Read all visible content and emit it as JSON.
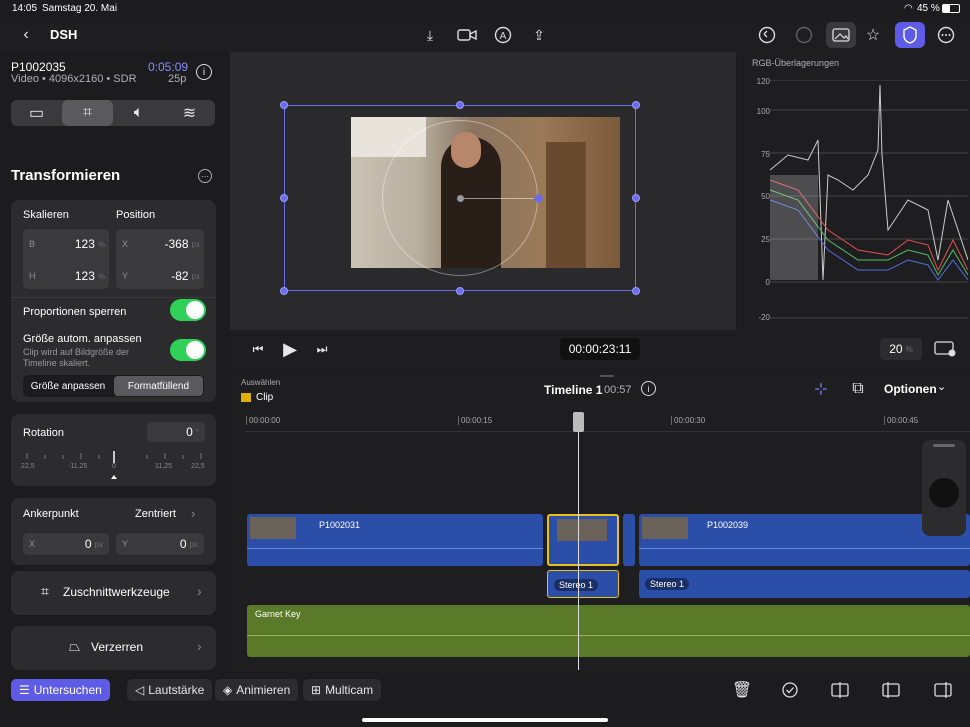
{
  "status": {
    "time": "14:05",
    "date": "Samstag 20. Mai",
    "battery": "45 %"
  },
  "topbar": {
    "project": "DSH",
    "back_icon": "chevron-left-icon"
  },
  "clipinfo": {
    "name": "P1002035",
    "timecode": "0:05:09",
    "meta": "Video • 4096x2160 • SDR",
    "fps": "25p"
  },
  "inspector": {
    "title": "Transformieren",
    "scale_label": "Skalieren",
    "position_label": "Position",
    "scale_w_label": "B",
    "scale_w": "123",
    "scale_h_label": "H",
    "scale_h": "123",
    "pct": "%",
    "pos_x_label": "X",
    "pos_x": "-368",
    "pos_y_label": "Y",
    "pos_y": "-82",
    "px": "px",
    "lock_label": "Proportionen sperren",
    "autofit_label": "Größe autom. anpassen",
    "autofit_sub": "Clip wird auf Bildgröße der Timeline skaliert.",
    "fit_label": "Größe anpassen",
    "fill_label": "Formatfüllend",
    "rotation_label": "Rotation",
    "rotation_value": "0",
    "deg": "°",
    "ticks": [
      "22,5",
      "-11,25",
      "0",
      "11,25",
      "22,5"
    ],
    "anchor_label": "Ankerpunkt",
    "anchor_value": "Zentriert",
    "anchor_x_label": "X",
    "anchor_x": "0",
    "anchor_y_label": "Y",
    "anchor_y": "0",
    "crop_label": "Zuschnittwerkzeuge",
    "distort_label": "Verzerren"
  },
  "scope": {
    "title": "RGB-Überlagerungen",
    "ticks": [
      "120",
      "100",
      "75",
      "50",
      "25",
      "0",
      "-20"
    ]
  },
  "transport": {
    "timecode": "00:00:23:11",
    "zoom": "20",
    "zoom_unit": "%"
  },
  "timeline": {
    "select_label": "Auswählen",
    "clip_mode": "Clip",
    "name": "Timeline 1",
    "duration": "00:57",
    "options": "Optionen",
    "ruler": [
      "00:00:00",
      "00:00:15",
      "00:00:30",
      "00:00:45"
    ],
    "clips": [
      "P1002031",
      "P1002039"
    ],
    "audio": [
      "Stereo 1",
      "Stereo 1"
    ],
    "music": "Garnet Key"
  },
  "bottom": {
    "inspect": "Untersuchen",
    "volume": "Lautstärke",
    "animate": "Animieren",
    "multicam": "Multicam"
  },
  "colors": {
    "accent": "#5e5ce6",
    "toggle": "#30d158",
    "clip": "#2b4fa8",
    "music": "#5a7a2a"
  }
}
